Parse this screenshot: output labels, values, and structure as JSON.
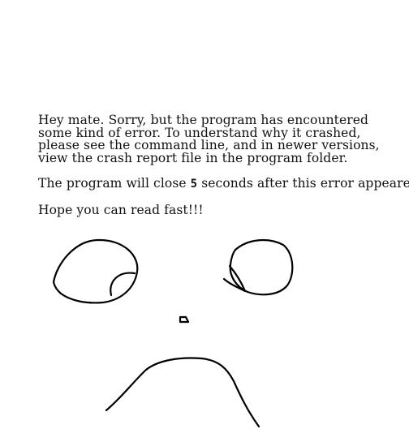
{
  "message": {
    "line1": "Hey mate. Sorry, but the program has encountered some kind of error. To understand why it crashed, please see the command line, and in newer versions, view the crash report file in the program folder.",
    "line2_before": "The program will close ",
    "countdown_seconds": "5",
    "line2_after": " seconds after this error appeared.",
    "line3": "Hope you can read fast!!!"
  }
}
